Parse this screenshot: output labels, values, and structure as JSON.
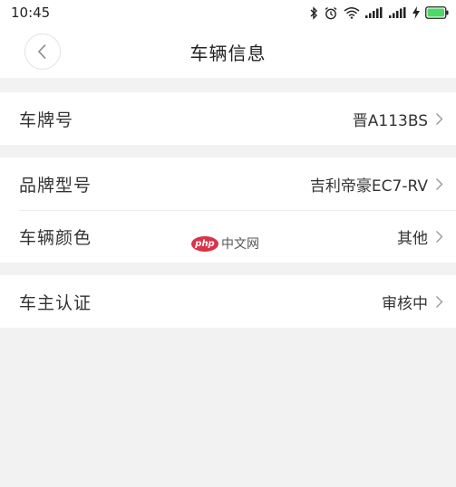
{
  "status_bar": {
    "time": "10:45",
    "icons": [
      "bluetooth-icon",
      "alarm-icon",
      "wifi-icon",
      "signal-icon",
      "signal-icon",
      "charging-icon",
      "battery-icon"
    ]
  },
  "nav": {
    "title": "车辆信息",
    "back_icon": "chevron-left-icon"
  },
  "sections": [
    {
      "rows": [
        {
          "label": "车牌号",
          "value": "晋A113BS"
        }
      ]
    },
    {
      "rows": [
        {
          "label": "品牌型号",
          "value": "吉利帝豪EC7-RV"
        },
        {
          "label": "车辆颜色",
          "value": "其他"
        }
      ]
    },
    {
      "rows": [
        {
          "label": "车主认证",
          "value": "审核中"
        }
      ]
    }
  ],
  "watermark": {
    "logo": "php",
    "text": "中文网"
  },
  "colors": {
    "background": "#f2f2f2",
    "surface": "#ffffff",
    "battery": "#4cd964",
    "watermark": "#d9334a"
  }
}
